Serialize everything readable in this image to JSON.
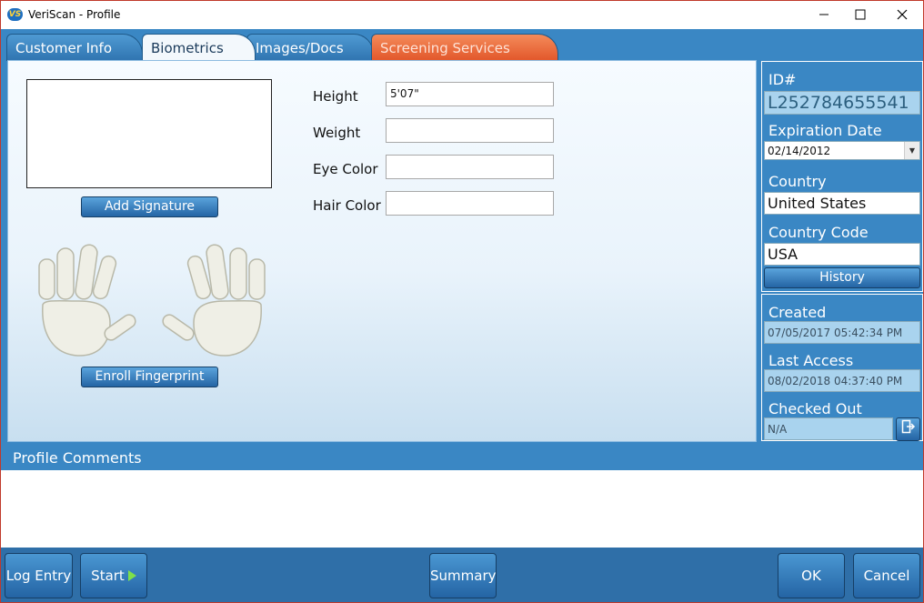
{
  "window": {
    "title": "VeriScan - Profile",
    "logo_text": "VS"
  },
  "tabs": [
    {
      "label": "Customer Info"
    },
    {
      "label": "Biometrics"
    },
    {
      "label": "Images/Docs"
    },
    {
      "label": "Screening Services"
    }
  ],
  "biometrics": {
    "add_signature": "Add Signature",
    "enroll_fingerprint": "Enroll Fingerprint",
    "fields": {
      "height_label": "Height",
      "height_value": "5'07\"",
      "weight_label": "Weight",
      "weight_value": "",
      "eye_label": "Eye Color",
      "eye_value": "",
      "hair_label": "Hair Color",
      "hair_value": ""
    }
  },
  "id_panel": {
    "id_label": "ID#",
    "id_value": "L252784655541",
    "exp_label": "Expiration Date",
    "exp_value": "02/14/2012",
    "country_label": "Country",
    "country_value": "United States",
    "code_label": "Country Code",
    "code_value": "USA",
    "history_button": "History"
  },
  "status_panel": {
    "created_label": "Created",
    "created_value": "07/05/2017 05:42:34 PM",
    "last_access_label": "Last Access",
    "last_access_value": "08/02/2018 04:37:40 PM",
    "checked_out_label": "Checked Out",
    "checked_out_value": "N/A"
  },
  "comments": {
    "title": "Profile Comments"
  },
  "footer": {
    "log_entry": "Log Entry",
    "start": "Start",
    "summary": "Summary",
    "ok": "OK",
    "cancel": "Cancel"
  },
  "icons": {
    "minimize": "minimize-icon",
    "maximize": "maximize-icon",
    "close": "close-icon",
    "play": "play-icon",
    "checkout": "exit-icon",
    "dropdown": "chevron-down-icon",
    "hands": "hands-icon"
  },
  "colors": {
    "accent": "#3a87c4",
    "screening_tab": "#e2562a",
    "start_arrow": "#7ee04a"
  }
}
